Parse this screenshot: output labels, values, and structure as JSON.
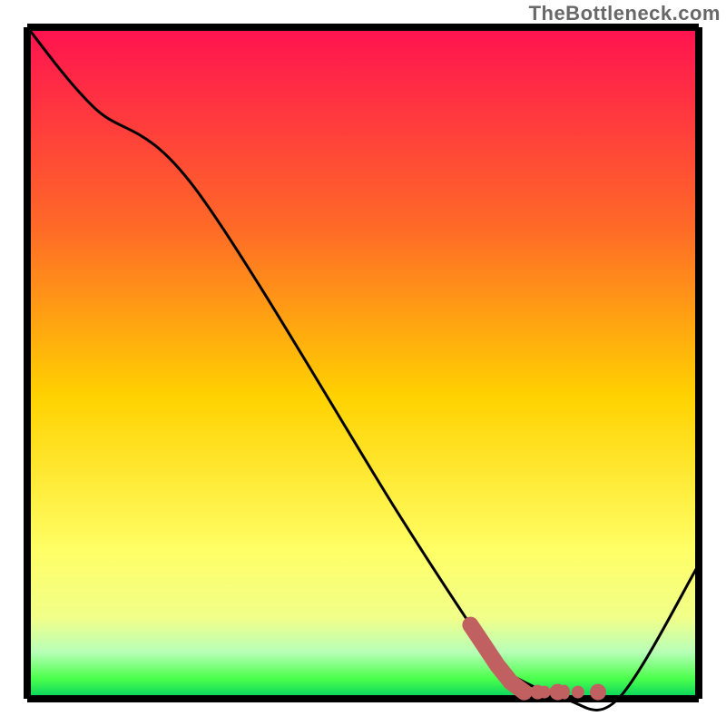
{
  "watermark": "TheBottleneck.com",
  "colors": {
    "grad_top": "#ff1250",
    "grad_upper_mid": "#ff6a27",
    "grad_mid": "#ffd200",
    "grad_lower_mid": "#ffff66",
    "grad_low": "#f1ff8a",
    "grad_green1": "#b8ffb8",
    "grad_green2": "#4cff4c",
    "grad_bottom": "#00d060",
    "axis": "#000000",
    "curve": "#000000",
    "marker": "#c16060"
  },
  "chart_data": {
    "type": "line",
    "title": "",
    "xlabel": "",
    "ylabel": "",
    "xlim": [
      0,
      100
    ],
    "ylim": [
      0,
      100
    ],
    "series": [
      {
        "name": "bottleneck-curve",
        "x": [
          0,
          10,
          25,
          55,
          66,
          70,
          80,
          88,
          100
        ],
        "y": [
          100,
          88,
          76,
          28,
          11,
          5,
          0,
          0,
          20
        ]
      }
    ],
    "markers": {
      "name": "highlight-segment",
      "points": [
        {
          "x": 66,
          "y": 11
        },
        {
          "x": 68,
          "y": 8
        },
        {
          "x": 70,
          "y": 5
        },
        {
          "x": 72,
          "y": 2.5
        },
        {
          "x": 74,
          "y": 1
        },
        {
          "x": 77,
          "y": 1
        },
        {
          "x": 79,
          "y": 1
        },
        {
          "x": 82,
          "y": 1
        },
        {
          "x": 85,
          "y": 1
        }
      ]
    }
  }
}
